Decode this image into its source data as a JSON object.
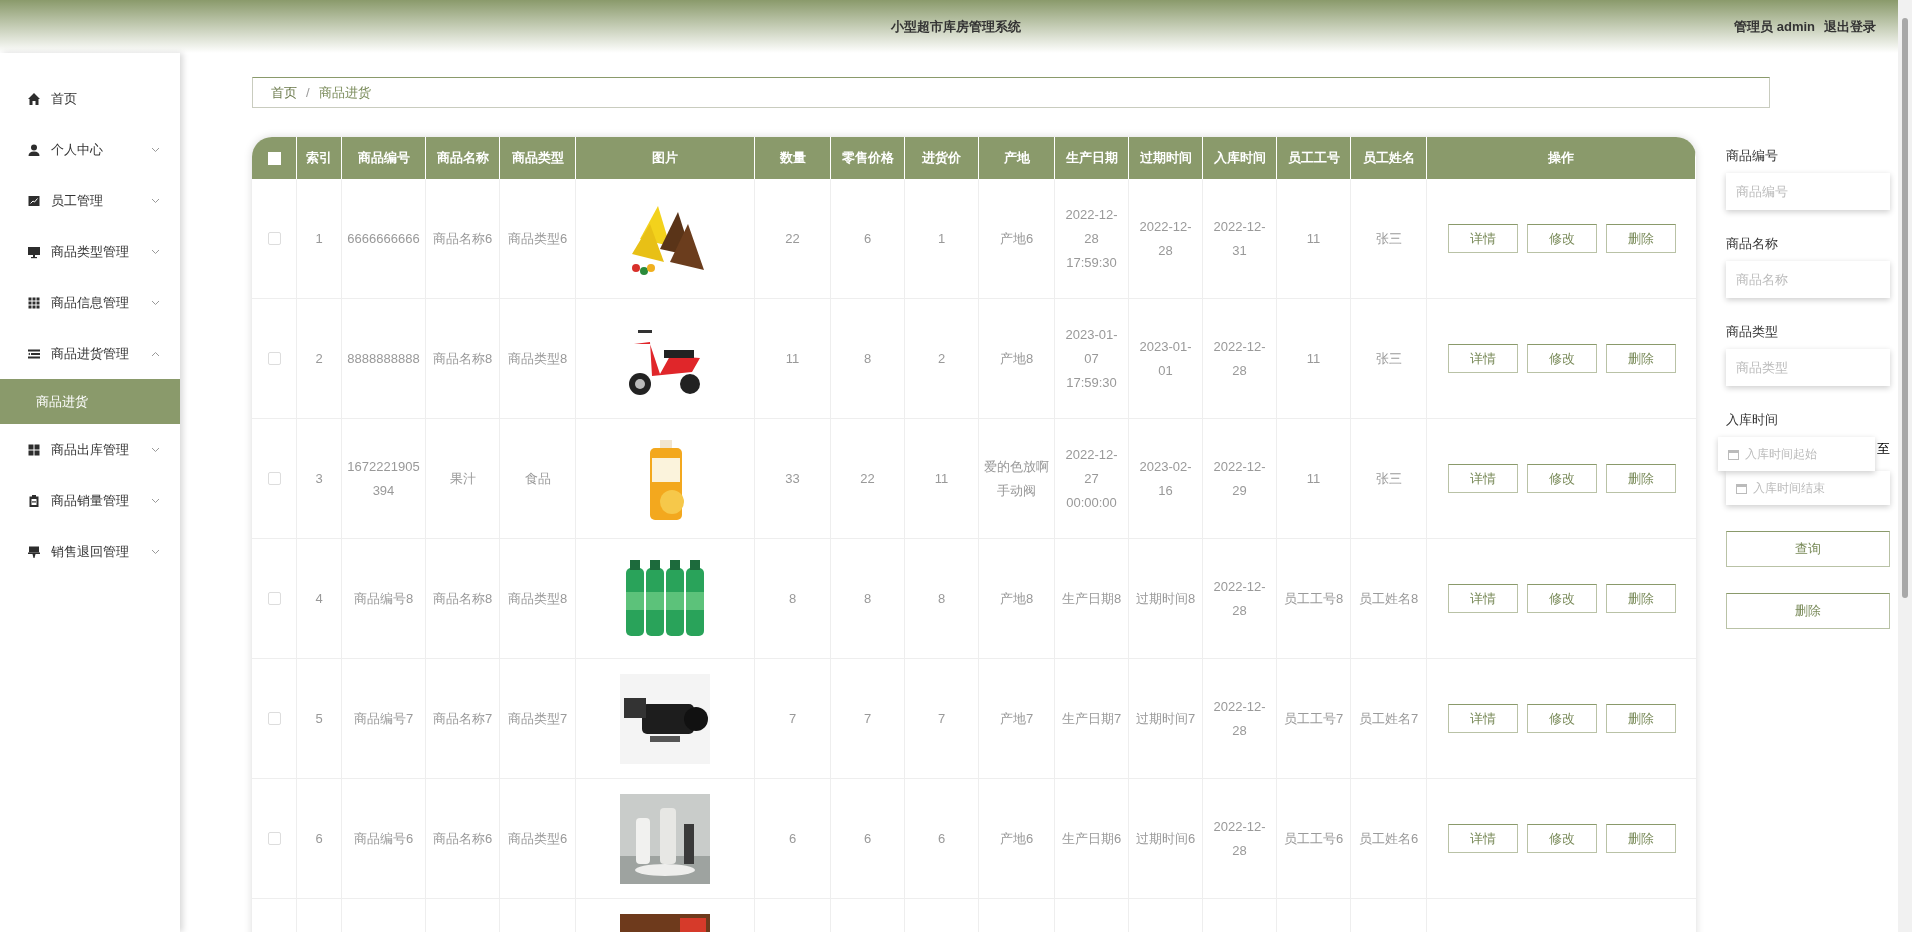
{
  "header": {
    "title": "小型超市库房管理系统",
    "user": "管理员 admin",
    "logout": "退出登录"
  },
  "sidebar": {
    "items": [
      {
        "label": "首页",
        "kind": "link"
      },
      {
        "label": "个人中心",
        "kind": "menu",
        "expanded": false
      },
      {
        "label": "员工管理",
        "kind": "menu",
        "expanded": false
      },
      {
        "label": "商品类型管理",
        "kind": "menu",
        "expanded": false
      },
      {
        "label": "商品信息管理",
        "kind": "menu",
        "expanded": false
      },
      {
        "label": "商品进货管理",
        "kind": "menu",
        "expanded": true,
        "children": [
          {
            "label": "商品进货",
            "selected": true
          }
        ]
      },
      {
        "label": "商品出库管理",
        "kind": "menu",
        "expanded": false
      },
      {
        "label": "商品销量管理",
        "kind": "menu",
        "expanded": false
      },
      {
        "label": "销售退回管理",
        "kind": "menu",
        "expanded": false
      }
    ]
  },
  "breadcrumb": {
    "items": [
      "首页",
      "商品进货"
    ],
    "separator": "/"
  },
  "table": {
    "select_all_checked": false,
    "columns": [
      "索引",
      "商品编号",
      "商品名称",
      "商品类型",
      "图片",
      "数量",
      "零售价格",
      "进货价",
      "产地",
      "生产日期",
      "过期时间",
      "入库时间",
      "员工工号",
      "员工姓名",
      "操作"
    ],
    "rows": [
      {
        "checked": false,
        "cells": [
          "1",
          "6666666666",
          "商品名称6",
          "商品类型6",
          "22",
          "6",
          "1",
          "产地6",
          "2022-12-28 17:59:30",
          "2022-12-28",
          "2022-12-31",
          "11",
          "张三"
        ],
        "image": {
          "kind": "picture"
        },
        "actions": [
          "详情",
          "修改",
          "删除"
        ]
      },
      {
        "checked": false,
        "cells": [
          "2",
          "8888888888",
          "商品名称8",
          "商品类型8",
          "11",
          "8",
          "2",
          "产地8",
          "2023-01-07 17:59:30",
          "2023-01-01",
          "2022-12-28",
          "11",
          "张三"
        ],
        "image": {
          "kind": "picture"
        },
        "actions": [
          "详情",
          "修改",
          "删除"
        ]
      },
      {
        "checked": false,
        "cells": [
          "3",
          "1672221905394",
          "果汁",
          "食品",
          "33",
          "22",
          "11",
          "爱的色放啊手动阀",
          "2022-12-27 00:00:00",
          "2023-02-16",
          "2022-12-29",
          "11",
          "张三"
        ],
        "image": {
          "kind": "picture"
        },
        "actions": [
          "详情",
          "修改",
          "删除"
        ]
      },
      {
        "checked": false,
        "cells": [
          "4",
          "商品编号8",
          "商品名称8",
          "商品类型8",
          "8",
          "8",
          "8",
          "产地8",
          "生产日期8",
          "过期时间8",
          "2022-12-28",
          "员工工号8",
          "员工姓名8"
        ],
        "image": {
          "kind": "picture"
        },
        "actions": [
          "详情",
          "修改",
          "删除"
        ]
      },
      {
        "checked": false,
        "cells": [
          "5",
          "商品编号7",
          "商品名称7",
          "商品类型7",
          "7",
          "7",
          "7",
          "产地7",
          "生产日期7",
          "过期时间7",
          "2022-12-28",
          "员工工号7",
          "员工姓名7"
        ],
        "image": {
          "kind": "picture"
        },
        "actions": [
          "详情",
          "修改",
          "删除"
        ]
      },
      {
        "checked": false,
        "cells": [
          "6",
          "商品编号6",
          "商品名称6",
          "商品类型6",
          "6",
          "6",
          "6",
          "产地6",
          "生产日期6",
          "过期时间6",
          "2022-12-28",
          "员工工号6",
          "员工姓名6"
        ],
        "image": {
          "kind": "picture"
        },
        "actions": [
          "详情",
          "修改",
          "删除"
        ]
      },
      {
        "image": {
          "kind": "picture"
        }
      }
    ]
  },
  "search": {
    "fields": [
      {
        "label": "商品编号",
        "placeholder": "商品编号"
      },
      {
        "label": "商品名称",
        "placeholder": "商品名称"
      },
      {
        "label": "商品类型",
        "placeholder": "商品类型"
      }
    ],
    "date": {
      "label": "入库时间",
      "start_placeholder": "入库时间起始",
      "separator": "至",
      "end_placeholder": "入库时间结束"
    },
    "buttons": [
      "查询",
      "删除"
    ]
  }
}
